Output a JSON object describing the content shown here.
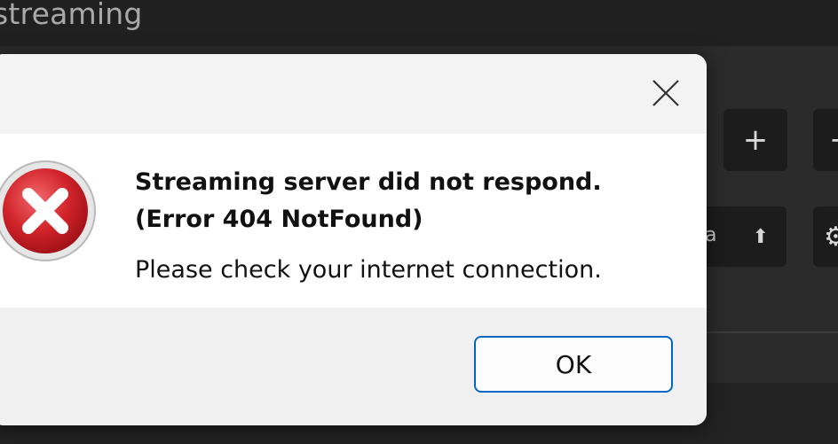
{
  "app": {
    "title": "streaming"
  },
  "background_controls": {
    "add_symbol": "+",
    "remove_symbol": "−",
    "upload_partial_text": "a",
    "upload_symbol": "⬆",
    "settings_symbol": "⚙"
  },
  "dialog": {
    "heading_line1": "Streaming server did not respond.",
    "heading_line2": "(Error 404 NotFound)",
    "message": "Please check your internet connection.",
    "ok_label": "OK",
    "icon": "error-icon",
    "close_icon": "close-icon"
  },
  "colors": {
    "accent": "#0067c0",
    "error_red": "#d1232a"
  }
}
